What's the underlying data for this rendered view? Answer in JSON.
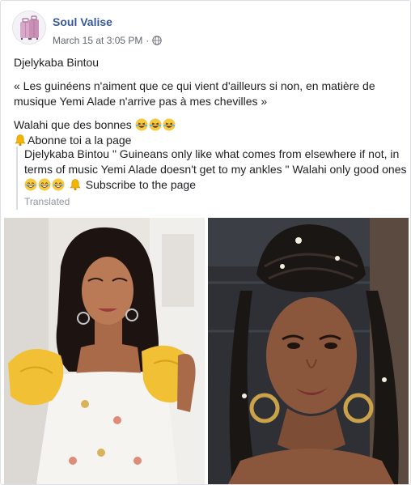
{
  "post": {
    "author": "Soul Valise",
    "timestamp": "March 15 at 3:05 PM",
    "separator": "·",
    "privacy_icon": "globe-icon",
    "lines": {
      "name": "Djelykaba Bintou",
      "quote": "« Les guinéens n'aiment que ce qui vient d'ailleurs si non, en matière de musique Yemi Alade n'arrive pas à mes chevilles »",
      "walahi": "Walahi que des bonnes",
      "subscribe": "Abonne toi a la page"
    },
    "translation": {
      "text_before": "Djelykaba Bintou \" Guineans only like what comes from elsewhere if not, in terms of music Yemi Alade doesn't get to my ankles \" Walahi only good ones",
      "text_after": "Subscribe to the page",
      "label": "Translated"
    }
  },
  "colors": {
    "author_link": "#385898",
    "meta_gray": "#616770",
    "translated_gray": "#90949c",
    "border": "#dddfe2"
  }
}
